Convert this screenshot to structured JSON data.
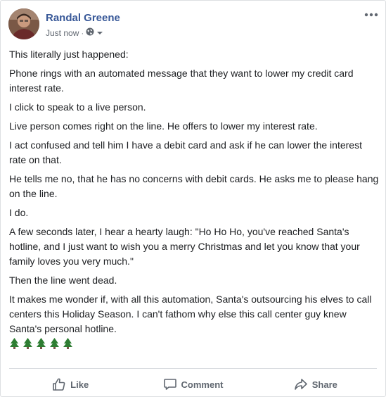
{
  "post": {
    "author": "Randal Greene",
    "timestamp": "Just now",
    "privacy_icon": "globe-icon",
    "paragraphs": [
      "This literally just happened:",
      "Phone rings with an automated message that they want to lower my credit card interest rate.",
      "I click to speak to a live person.",
      "Live person comes right on the line. He offers to lower my interest rate.",
      "I act confused and tell him I have a debit card and ask if he can lower the interest rate on that.",
      "He tells me no, that he has no concerns with debit cards. He asks me to please hang on the line.",
      "I do.",
      "A few seconds later, I hear a hearty laugh: \"Ho Ho Ho, you've reached Santa's hotline, and I just want to wish you a merry Christmas and let you know that your family loves you very much.\"",
      "Then the line went dead.",
      "It makes me wonder if, with all this automation, Santa's outsourcing his elves to call centers this Holiday Season. I can't fathom why else this call center guy knew Santa's personal hotline."
    ],
    "emoji_icons": [
      "tree-icon",
      "tree-icon",
      "tree-icon",
      "tree-icon",
      "tree-icon"
    ]
  },
  "actions": {
    "like": "Like",
    "comment": "Comment",
    "share": "Share"
  },
  "colors": {
    "author": "#385898",
    "meta": "#606770",
    "text": "#1c1e21",
    "tree": "#2e7d32"
  }
}
